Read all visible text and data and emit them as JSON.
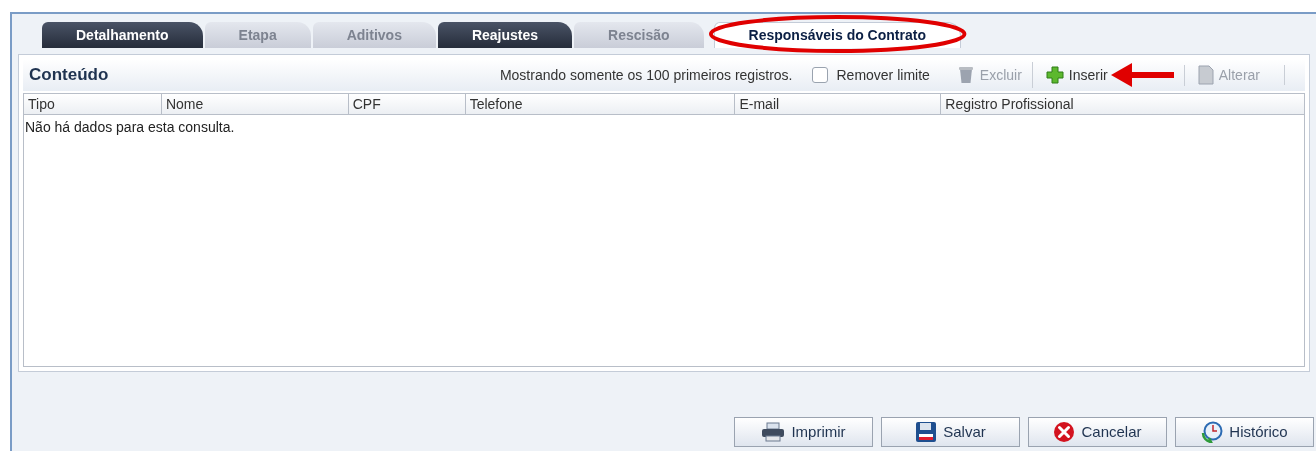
{
  "tabs": [
    {
      "label": "Detalhamento",
      "selected": false,
      "disabled": false
    },
    {
      "label": "Etapa",
      "selected": false,
      "disabled": true
    },
    {
      "label": "Aditivos",
      "selected": false,
      "disabled": true
    },
    {
      "label": "Reajustes",
      "selected": false,
      "disabled": false
    },
    {
      "label": "Rescisão",
      "selected": false,
      "disabled": true
    },
    {
      "label": "Responsáveis do Contrato",
      "selected": true,
      "disabled": false
    }
  ],
  "panel": {
    "title": "Conteúdo",
    "notice": "Mostrando somente os 100 primeiros registros.",
    "limit_checkbox": {
      "label": "Remover limite",
      "checked": false
    },
    "toolbar": [
      {
        "kind": "delete",
        "label": "Excluir",
        "disabled": true
      },
      {
        "kind": "insert",
        "label": "Inserir",
        "disabled": false
      },
      {
        "kind": "edit",
        "label": "Alterar",
        "disabled": true
      }
    ],
    "table": {
      "columns": [
        "Tipo",
        "Nome",
        "CPF",
        "Telefone",
        "E-mail",
        "Registro Profissional"
      ],
      "empty_message": "Não há dados para esta consulta."
    }
  },
  "buttons": [
    {
      "kind": "print",
      "label": "Imprimir"
    },
    {
      "kind": "save",
      "label": "Salvar"
    },
    {
      "kind": "cancel",
      "label": "Cancelar"
    },
    {
      "kind": "history",
      "label": "Histórico"
    }
  ]
}
